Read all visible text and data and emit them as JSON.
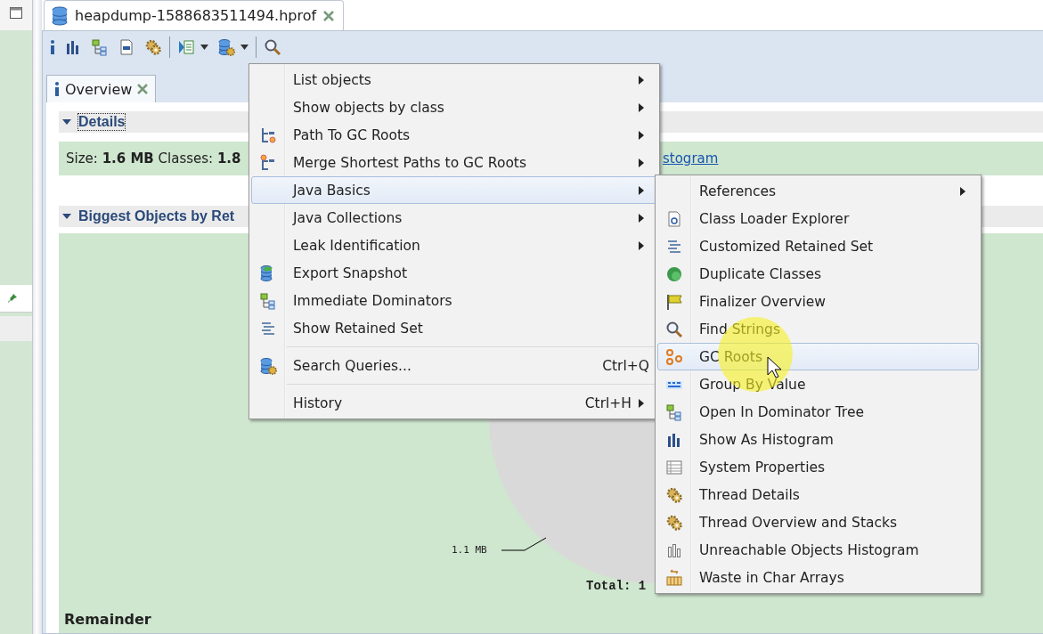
{
  "editor_tab": {
    "title": "heapdump-1588683511494.hprof",
    "selected": true
  },
  "toolbar": {
    "buttons": [
      {
        "kind": "info"
      },
      {
        "kind": "histogram"
      },
      {
        "kind": "tree"
      },
      {
        "kind": "query"
      },
      {
        "kind": "gears"
      },
      {
        "kind": "separator"
      },
      {
        "kind": "run-list",
        "dropdown": true
      },
      {
        "kind": "db-gear",
        "dropdown": true
      },
      {
        "kind": "separator"
      },
      {
        "kind": "search"
      }
    ]
  },
  "view_tab": {
    "label": "Overview",
    "selected": true
  },
  "details": {
    "title": "Details",
    "expanded": true,
    "text": "Size: **1.6 MB** Classes: **1.8**",
    "link": "stogram"
  },
  "biggest_objects": {
    "title": "Biggest Objects by Ret",
    "expanded": true,
    "slice_label": "1.1 MB",
    "total": "Total: 1",
    "legend": "Remainder"
  },
  "menu": {
    "items": [
      {
        "kind": "item",
        "label": "List objects",
        "submenu": true,
        "selected": false
      },
      {
        "kind": "item",
        "label": "Show objects by class",
        "submenu": true,
        "selected": false
      },
      {
        "kind": "item",
        "label": "Path To GC Roots",
        "submenu": true,
        "selected": false
      },
      {
        "kind": "item",
        "label": "Merge Shortest Paths to GC Roots",
        "submenu": true,
        "selected": false
      },
      {
        "kind": "item",
        "label": "Java Basics",
        "submenu": true,
        "selected": true
      },
      {
        "kind": "item",
        "label": "Java Collections",
        "submenu": true,
        "selected": false
      },
      {
        "kind": "item",
        "label": "Leak Identification",
        "submenu": true,
        "selected": false
      },
      {
        "kind": "item",
        "label": "Export Snapshot",
        "selected": false
      },
      {
        "kind": "item",
        "label": "Immediate Dominators",
        "selected": false
      },
      {
        "kind": "item",
        "label": "Show Retained Set",
        "selected": false
      },
      {
        "kind": "separator"
      },
      {
        "kind": "item",
        "label": "Search Queries...",
        "shortcut": "Ctrl+Q",
        "selected": false
      },
      {
        "kind": "separator"
      },
      {
        "kind": "item",
        "label": "History",
        "shortcut": "Ctrl+H",
        "submenu": true,
        "selected": false
      }
    ]
  },
  "submenu": {
    "items": [
      {
        "kind": "item",
        "label": "References",
        "submenu": true,
        "selected": false
      },
      {
        "kind": "item",
        "label": "Class Loader Explorer",
        "selected": false
      },
      {
        "kind": "item",
        "label": "Customized Retained Set",
        "selected": false
      },
      {
        "kind": "item",
        "label": "Duplicate Classes",
        "selected": false
      },
      {
        "kind": "item",
        "label": "Finalizer Overview",
        "selected": false
      },
      {
        "kind": "item",
        "label": "Find Strings",
        "selected": false
      },
      {
        "kind": "item",
        "label": "GC Roots",
        "selected": true
      },
      {
        "kind": "item",
        "label": "Group By Value",
        "selected": false
      },
      {
        "kind": "item",
        "label": "Open In Dominator Tree",
        "selected": false
      },
      {
        "kind": "item",
        "label": "Show As Histogram",
        "selected": false
      },
      {
        "kind": "item",
        "label": "System Properties",
        "selected": false
      },
      {
        "kind": "item",
        "label": "Thread Details",
        "selected": false
      },
      {
        "kind": "item",
        "label": "Thread Overview and Stacks",
        "selected": false
      },
      {
        "kind": "item",
        "label": "Unreachable Objects Histogram",
        "selected": false
      },
      {
        "kind": "item",
        "label": "Waste in Char Arrays",
        "selected": false
      }
    ]
  }
}
